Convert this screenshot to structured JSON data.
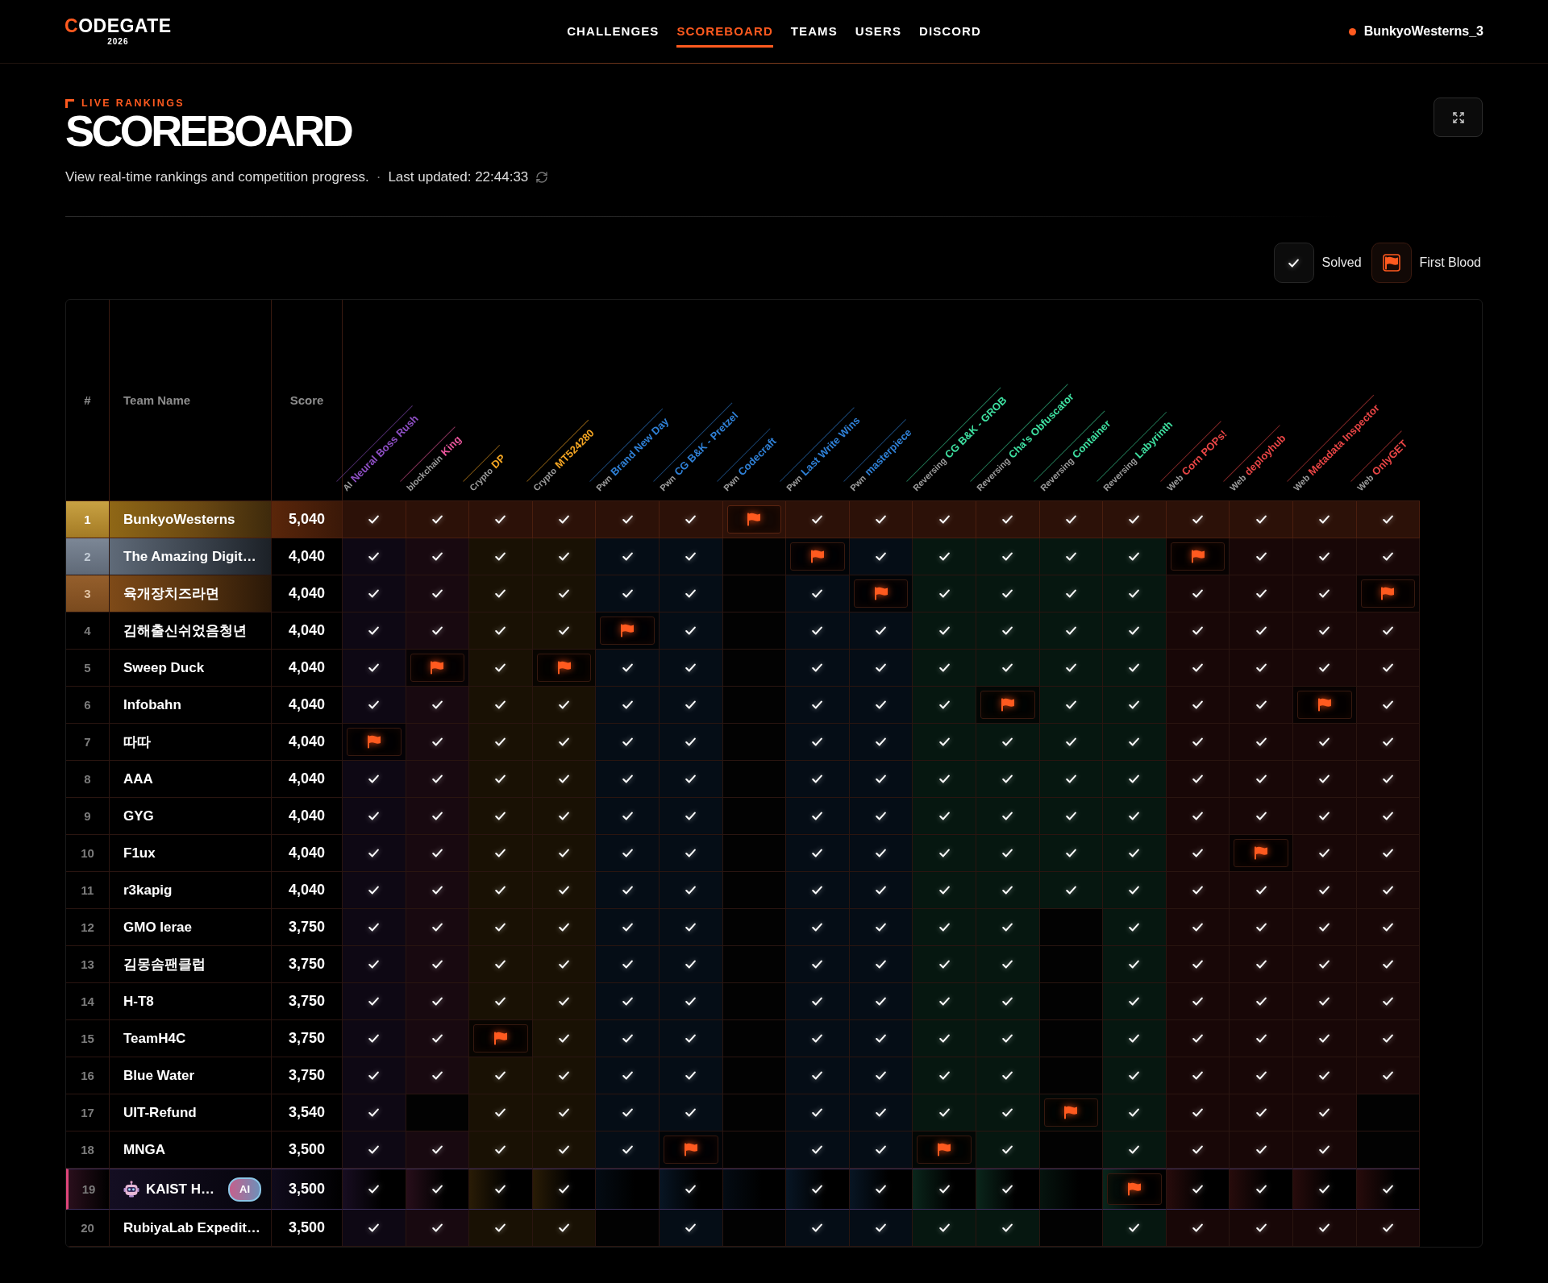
{
  "nav": {
    "logo": {
      "text": "CODEGATE",
      "year": "2026"
    },
    "links": [
      {
        "label": "CHALLENGES",
        "selected": false
      },
      {
        "label": "SCOREBOARD",
        "selected": true
      },
      {
        "label": "TEAMS",
        "selected": false
      },
      {
        "label": "USERS",
        "selected": false
      },
      {
        "label": "DISCORD",
        "selected": false
      }
    ],
    "user": "BunkyoWesterns_3"
  },
  "header": {
    "eyebrow": "LIVE RANKINGS",
    "title": "SCOREBOARD",
    "subtitle": "View real-time rankings and competition progress.",
    "separator": "·",
    "last_updated": "Last updated: 22:44:33"
  },
  "legend": [
    {
      "kind": "check",
      "label": "Solved"
    },
    {
      "kind": "flag",
      "label": "First Blood"
    }
  ],
  "table": {
    "columns": [
      "#",
      "Team Name",
      "Score"
    ],
    "challenges": [
      {
        "category": "AI",
        "name": "Neural Boss Rush",
        "color": "#8e4fc4"
      },
      {
        "category": "blockchain",
        "name": "King",
        "color": "#e9559b"
      },
      {
        "category": "Crypto",
        "name": "DP",
        "color": "#f5a623"
      },
      {
        "category": "Crypto",
        "name": "MT524280",
        "color": "#f5a623"
      },
      {
        "category": "Pwn",
        "name": "Brand New Day",
        "color": "#2f80d6"
      },
      {
        "category": "Pwn",
        "name": "CG B&K - Pretzel",
        "color": "#2f80d6"
      },
      {
        "category": "Pwn",
        "name": "Codecraft",
        "color": "#2f80d6"
      },
      {
        "category": "Pwn",
        "name": "Last Write Wins",
        "color": "#2f80d6"
      },
      {
        "category": "Pwn",
        "name": "masterpiece",
        "color": "#2f80d6"
      },
      {
        "category": "Reversing",
        "name": "CG B&K - GROB",
        "color": "#3ee0a1"
      },
      {
        "category": "Reversing",
        "name": "Cha's Obfuscator",
        "color": "#3ee0a1"
      },
      {
        "category": "Reversing",
        "name": "Container",
        "color": "#3ee0a1"
      },
      {
        "category": "Reversing",
        "name": "Labyrinth",
        "color": "#3ee0a1"
      },
      {
        "category": "Web",
        "name": "Corn POPs!",
        "color": "#e84545"
      },
      {
        "category": "Web",
        "name": "deployhub",
        "color": "#e84545"
      },
      {
        "category": "Web",
        "name": "Metadata Inspector",
        "color": "#e84545"
      },
      {
        "category": "Web",
        "name": "OnlyGET",
        "color": "#e84545"
      }
    ],
    "rows": [
      {
        "rank": "1",
        "team": "BunkyoWesterns",
        "score": "5,040",
        "kind": "gold",
        "cells": [
          {
            "solved": true,
            "first_blood": false
          },
          {
            "solved": true,
            "first_blood": false
          },
          {
            "solved": true,
            "first_blood": false
          },
          {
            "solved": true,
            "first_blood": false
          },
          {
            "solved": true,
            "first_blood": false
          },
          {
            "solved": true,
            "first_blood": false
          },
          {
            "solved": true,
            "first_blood": true
          },
          {
            "solved": true,
            "first_blood": false
          },
          {
            "solved": true,
            "first_blood": false
          },
          {
            "solved": true,
            "first_blood": false
          },
          {
            "solved": true,
            "first_blood": false
          },
          {
            "solved": true,
            "first_blood": false
          },
          {
            "solved": true,
            "first_blood": false
          },
          {
            "solved": true,
            "first_blood": false
          },
          {
            "solved": true,
            "first_blood": false
          },
          {
            "solved": true,
            "first_blood": false
          },
          {
            "solved": true,
            "first_blood": false
          }
        ]
      },
      {
        "rank": "2",
        "team": "The Amazing Digit…",
        "score": "4,040",
        "kind": "silver",
        "cells": [
          {
            "solved": true,
            "first_blood": false
          },
          {
            "solved": true,
            "first_blood": false
          },
          {
            "solved": true,
            "first_blood": false
          },
          {
            "solved": true,
            "first_blood": false
          },
          {
            "solved": true,
            "first_blood": false
          },
          {
            "solved": true,
            "first_blood": false
          },
          {
            "solved": false,
            "first_blood": false
          },
          {
            "solved": true,
            "first_blood": true
          },
          {
            "solved": true,
            "first_blood": false
          },
          {
            "solved": true,
            "first_blood": false
          },
          {
            "solved": true,
            "first_blood": false
          },
          {
            "solved": true,
            "first_blood": false
          },
          {
            "solved": true,
            "first_blood": false
          },
          {
            "solved": true,
            "first_blood": true
          },
          {
            "solved": true,
            "first_blood": false
          },
          {
            "solved": true,
            "first_blood": false
          },
          {
            "solved": true,
            "first_blood": false
          }
        ]
      },
      {
        "rank": "3",
        "team": "육개장치즈라면",
        "score": "4,040",
        "kind": "bronze",
        "cells": [
          {
            "solved": true,
            "first_blood": false
          },
          {
            "solved": true,
            "first_blood": false
          },
          {
            "solved": true,
            "first_blood": false
          },
          {
            "solved": true,
            "first_blood": false
          },
          {
            "solved": true,
            "first_blood": false
          },
          {
            "solved": true,
            "first_blood": false
          },
          {
            "solved": false,
            "first_blood": false
          },
          {
            "solved": true,
            "first_blood": false
          },
          {
            "solved": true,
            "first_blood": true
          },
          {
            "solved": true,
            "first_blood": false
          },
          {
            "solved": true,
            "first_blood": false
          },
          {
            "solved": true,
            "first_blood": false
          },
          {
            "solved": true,
            "first_blood": false
          },
          {
            "solved": true,
            "first_blood": false
          },
          {
            "solved": true,
            "first_blood": false
          },
          {
            "solved": true,
            "first_blood": false
          },
          {
            "solved": true,
            "first_blood": true
          }
        ]
      },
      {
        "rank": "4",
        "team": "김해출신쉬었음청년",
        "score": "4,040",
        "kind": "normal",
        "cells": [
          {
            "solved": true,
            "first_blood": false
          },
          {
            "solved": true,
            "first_blood": false
          },
          {
            "solved": true,
            "first_blood": false
          },
          {
            "solved": true,
            "first_blood": false
          },
          {
            "solved": true,
            "first_blood": true
          },
          {
            "solved": true,
            "first_blood": false
          },
          {
            "solved": false,
            "first_blood": false
          },
          {
            "solved": true,
            "first_blood": false
          },
          {
            "solved": true,
            "first_blood": false
          },
          {
            "solved": true,
            "first_blood": false
          },
          {
            "solved": true,
            "first_blood": false
          },
          {
            "solved": true,
            "first_blood": false
          },
          {
            "solved": true,
            "first_blood": false
          },
          {
            "solved": true,
            "first_blood": false
          },
          {
            "solved": true,
            "first_blood": false
          },
          {
            "solved": true,
            "first_blood": false
          },
          {
            "solved": true,
            "first_blood": false
          }
        ]
      },
      {
        "rank": "5",
        "team": "Sweep Duck",
        "score": "4,040",
        "kind": "normal",
        "cells": [
          {
            "solved": true,
            "first_blood": false
          },
          {
            "solved": true,
            "first_blood": true
          },
          {
            "solved": true,
            "first_blood": false
          },
          {
            "solved": true,
            "first_blood": true
          },
          {
            "solved": true,
            "first_blood": false
          },
          {
            "solved": true,
            "first_blood": false
          },
          {
            "solved": false,
            "first_blood": false
          },
          {
            "solved": true,
            "first_blood": false
          },
          {
            "solved": true,
            "first_blood": false
          },
          {
            "solved": true,
            "first_blood": false
          },
          {
            "solved": true,
            "first_blood": false
          },
          {
            "solved": true,
            "first_blood": false
          },
          {
            "solved": true,
            "first_blood": false
          },
          {
            "solved": true,
            "first_blood": false
          },
          {
            "solved": true,
            "first_blood": false
          },
          {
            "solved": true,
            "first_blood": false
          },
          {
            "solved": true,
            "first_blood": false
          }
        ]
      },
      {
        "rank": "6",
        "team": "Infobahn",
        "score": "4,040",
        "kind": "normal",
        "cells": [
          {
            "solved": true,
            "first_blood": false
          },
          {
            "solved": true,
            "first_blood": false
          },
          {
            "solved": true,
            "first_blood": false
          },
          {
            "solved": true,
            "first_blood": false
          },
          {
            "solved": true,
            "first_blood": false
          },
          {
            "solved": true,
            "first_blood": false
          },
          {
            "solved": false,
            "first_blood": false
          },
          {
            "solved": true,
            "first_blood": false
          },
          {
            "solved": true,
            "first_blood": false
          },
          {
            "solved": true,
            "first_blood": false
          },
          {
            "solved": true,
            "first_blood": true
          },
          {
            "solved": true,
            "first_blood": false
          },
          {
            "solved": true,
            "first_blood": false
          },
          {
            "solved": true,
            "first_blood": false
          },
          {
            "solved": true,
            "first_blood": false
          },
          {
            "solved": true,
            "first_blood": true
          },
          {
            "solved": true,
            "first_blood": false
          }
        ]
      },
      {
        "rank": "7",
        "team": "따따",
        "score": "4,040",
        "kind": "normal",
        "cells": [
          {
            "solved": true,
            "first_blood": true
          },
          {
            "solved": true,
            "first_blood": false
          },
          {
            "solved": true,
            "first_blood": false
          },
          {
            "solved": true,
            "first_blood": false
          },
          {
            "solved": true,
            "first_blood": false
          },
          {
            "solved": true,
            "first_blood": false
          },
          {
            "solved": false,
            "first_blood": false
          },
          {
            "solved": true,
            "first_blood": false
          },
          {
            "solved": true,
            "first_blood": false
          },
          {
            "solved": true,
            "first_blood": false
          },
          {
            "solved": true,
            "first_blood": false
          },
          {
            "solved": true,
            "first_blood": false
          },
          {
            "solved": true,
            "first_blood": false
          },
          {
            "solved": true,
            "first_blood": false
          },
          {
            "solved": true,
            "first_blood": false
          },
          {
            "solved": true,
            "first_blood": false
          },
          {
            "solved": true,
            "first_blood": false
          }
        ]
      },
      {
        "rank": "8",
        "team": "AAA",
        "score": "4,040",
        "kind": "normal",
        "cells": [
          {
            "solved": true,
            "first_blood": false
          },
          {
            "solved": true,
            "first_blood": false
          },
          {
            "solved": true,
            "first_blood": false
          },
          {
            "solved": true,
            "first_blood": false
          },
          {
            "solved": true,
            "first_blood": false
          },
          {
            "solved": true,
            "first_blood": false
          },
          {
            "solved": false,
            "first_blood": false
          },
          {
            "solved": true,
            "first_blood": false
          },
          {
            "solved": true,
            "first_blood": false
          },
          {
            "solved": true,
            "first_blood": false
          },
          {
            "solved": true,
            "first_blood": false
          },
          {
            "solved": true,
            "first_blood": false
          },
          {
            "solved": true,
            "first_blood": false
          },
          {
            "solved": true,
            "first_blood": false
          },
          {
            "solved": true,
            "first_blood": false
          },
          {
            "solved": true,
            "first_blood": false
          },
          {
            "solved": true,
            "first_blood": false
          }
        ]
      },
      {
        "rank": "9",
        "team": "GYG",
        "score": "4,040",
        "kind": "normal",
        "cells": [
          {
            "solved": true,
            "first_blood": false
          },
          {
            "solved": true,
            "first_blood": false
          },
          {
            "solved": true,
            "first_blood": false
          },
          {
            "solved": true,
            "first_blood": false
          },
          {
            "solved": true,
            "first_blood": false
          },
          {
            "solved": true,
            "first_blood": false
          },
          {
            "solved": false,
            "first_blood": false
          },
          {
            "solved": true,
            "first_blood": false
          },
          {
            "solved": true,
            "first_blood": false
          },
          {
            "solved": true,
            "first_blood": false
          },
          {
            "solved": true,
            "first_blood": false
          },
          {
            "solved": true,
            "first_blood": false
          },
          {
            "solved": true,
            "first_blood": false
          },
          {
            "solved": true,
            "first_blood": false
          },
          {
            "solved": true,
            "first_blood": false
          },
          {
            "solved": true,
            "first_blood": false
          },
          {
            "solved": true,
            "first_blood": false
          }
        ]
      },
      {
        "rank": "10",
        "team": "F1ux",
        "score": "4,040",
        "kind": "normal",
        "cells": [
          {
            "solved": true,
            "first_blood": false
          },
          {
            "solved": true,
            "first_blood": false
          },
          {
            "solved": true,
            "first_blood": false
          },
          {
            "solved": true,
            "first_blood": false
          },
          {
            "solved": true,
            "first_blood": false
          },
          {
            "solved": true,
            "first_blood": false
          },
          {
            "solved": false,
            "first_blood": false
          },
          {
            "solved": true,
            "first_blood": false
          },
          {
            "solved": true,
            "first_blood": false
          },
          {
            "solved": true,
            "first_blood": false
          },
          {
            "solved": true,
            "first_blood": false
          },
          {
            "solved": true,
            "first_blood": false
          },
          {
            "solved": true,
            "first_blood": false
          },
          {
            "solved": true,
            "first_blood": false
          },
          {
            "solved": true,
            "first_blood": true
          },
          {
            "solved": true,
            "first_blood": false
          },
          {
            "solved": true,
            "first_blood": false
          }
        ]
      },
      {
        "rank": "11",
        "team": "r3kapig",
        "score": "4,040",
        "kind": "normal",
        "cells": [
          {
            "solved": true,
            "first_blood": false
          },
          {
            "solved": true,
            "first_blood": false
          },
          {
            "solved": true,
            "first_blood": false
          },
          {
            "solved": true,
            "first_blood": false
          },
          {
            "solved": true,
            "first_blood": false
          },
          {
            "solved": true,
            "first_blood": false
          },
          {
            "solved": false,
            "first_blood": false
          },
          {
            "solved": true,
            "first_blood": false
          },
          {
            "solved": true,
            "first_blood": false
          },
          {
            "solved": true,
            "first_blood": false
          },
          {
            "solved": true,
            "first_blood": false
          },
          {
            "solved": true,
            "first_blood": false
          },
          {
            "solved": true,
            "first_blood": false
          },
          {
            "solved": true,
            "first_blood": false
          },
          {
            "solved": true,
            "first_blood": false
          },
          {
            "solved": true,
            "first_blood": false
          },
          {
            "solved": true,
            "first_blood": false
          }
        ]
      },
      {
        "rank": "12",
        "team": "GMO Ierae",
        "score": "3,750",
        "kind": "normal",
        "cells": [
          {
            "solved": true,
            "first_blood": false
          },
          {
            "solved": true,
            "first_blood": false
          },
          {
            "solved": true,
            "first_blood": false
          },
          {
            "solved": true,
            "first_blood": false
          },
          {
            "solved": true,
            "first_blood": false
          },
          {
            "solved": true,
            "first_blood": false
          },
          {
            "solved": false,
            "first_blood": false
          },
          {
            "solved": true,
            "first_blood": false
          },
          {
            "solved": true,
            "first_blood": false
          },
          {
            "solved": true,
            "first_blood": false
          },
          {
            "solved": true,
            "first_blood": false
          },
          {
            "solved": false,
            "first_blood": false
          },
          {
            "solved": true,
            "first_blood": false
          },
          {
            "solved": true,
            "first_blood": false
          },
          {
            "solved": true,
            "first_blood": false
          },
          {
            "solved": true,
            "first_blood": false
          },
          {
            "solved": true,
            "first_blood": false
          }
        ]
      },
      {
        "rank": "13",
        "team": "김몽솜팬클럽",
        "score": "3,750",
        "kind": "normal",
        "cells": [
          {
            "solved": true,
            "first_blood": false
          },
          {
            "solved": true,
            "first_blood": false
          },
          {
            "solved": true,
            "first_blood": false
          },
          {
            "solved": true,
            "first_blood": false
          },
          {
            "solved": true,
            "first_blood": false
          },
          {
            "solved": true,
            "first_blood": false
          },
          {
            "solved": false,
            "first_blood": false
          },
          {
            "solved": true,
            "first_blood": false
          },
          {
            "solved": true,
            "first_blood": false
          },
          {
            "solved": true,
            "first_blood": false
          },
          {
            "solved": true,
            "first_blood": false
          },
          {
            "solved": false,
            "first_blood": false
          },
          {
            "solved": true,
            "first_blood": false
          },
          {
            "solved": true,
            "first_blood": false
          },
          {
            "solved": true,
            "first_blood": false
          },
          {
            "solved": true,
            "first_blood": false
          },
          {
            "solved": true,
            "first_blood": false
          }
        ]
      },
      {
        "rank": "14",
        "team": "H-T8",
        "score": "3,750",
        "kind": "normal",
        "cells": [
          {
            "solved": true,
            "first_blood": false
          },
          {
            "solved": true,
            "first_blood": false
          },
          {
            "solved": true,
            "first_blood": false
          },
          {
            "solved": true,
            "first_blood": false
          },
          {
            "solved": true,
            "first_blood": false
          },
          {
            "solved": true,
            "first_blood": false
          },
          {
            "solved": false,
            "first_blood": false
          },
          {
            "solved": true,
            "first_blood": false
          },
          {
            "solved": true,
            "first_blood": false
          },
          {
            "solved": true,
            "first_blood": false
          },
          {
            "solved": true,
            "first_blood": false
          },
          {
            "solved": false,
            "first_blood": false
          },
          {
            "solved": true,
            "first_blood": false
          },
          {
            "solved": true,
            "first_blood": false
          },
          {
            "solved": true,
            "first_blood": false
          },
          {
            "solved": true,
            "first_blood": false
          },
          {
            "solved": true,
            "first_blood": false
          }
        ]
      },
      {
        "rank": "15",
        "team": "TeamH4C",
        "score": "3,750",
        "kind": "normal",
        "cells": [
          {
            "solved": true,
            "first_blood": false
          },
          {
            "solved": true,
            "first_blood": false
          },
          {
            "solved": true,
            "first_blood": true
          },
          {
            "solved": true,
            "first_blood": false
          },
          {
            "solved": true,
            "first_blood": false
          },
          {
            "solved": true,
            "first_blood": false
          },
          {
            "solved": false,
            "first_blood": false
          },
          {
            "solved": true,
            "first_blood": false
          },
          {
            "solved": true,
            "first_blood": false
          },
          {
            "solved": true,
            "first_blood": false
          },
          {
            "solved": true,
            "first_blood": false
          },
          {
            "solved": false,
            "first_blood": false
          },
          {
            "solved": true,
            "first_blood": false
          },
          {
            "solved": true,
            "first_blood": false
          },
          {
            "solved": true,
            "first_blood": false
          },
          {
            "solved": true,
            "first_blood": false
          },
          {
            "solved": true,
            "first_blood": false
          }
        ]
      },
      {
        "rank": "16",
        "team": "Blue Water",
        "score": "3,750",
        "kind": "normal",
        "cells": [
          {
            "solved": true,
            "first_blood": false
          },
          {
            "solved": true,
            "first_blood": false
          },
          {
            "solved": true,
            "first_blood": false
          },
          {
            "solved": true,
            "first_blood": false
          },
          {
            "solved": true,
            "first_blood": false
          },
          {
            "solved": true,
            "first_blood": false
          },
          {
            "solved": false,
            "first_blood": false
          },
          {
            "solved": true,
            "first_blood": false
          },
          {
            "solved": true,
            "first_blood": false
          },
          {
            "solved": true,
            "first_blood": false
          },
          {
            "solved": true,
            "first_blood": false
          },
          {
            "solved": false,
            "first_blood": false
          },
          {
            "solved": true,
            "first_blood": false
          },
          {
            "solved": true,
            "first_blood": false
          },
          {
            "solved": true,
            "first_blood": false
          },
          {
            "solved": true,
            "first_blood": false
          },
          {
            "solved": true,
            "first_blood": false
          }
        ]
      },
      {
        "rank": "17",
        "team": "UIT-Refund",
        "score": "3,540",
        "kind": "normal",
        "cells": [
          {
            "solved": true,
            "first_blood": false
          },
          {
            "solved": false,
            "first_blood": false
          },
          {
            "solved": true,
            "first_blood": false
          },
          {
            "solved": true,
            "first_blood": false
          },
          {
            "solved": true,
            "first_blood": false
          },
          {
            "solved": true,
            "first_blood": false
          },
          {
            "solved": false,
            "first_blood": false
          },
          {
            "solved": true,
            "first_blood": false
          },
          {
            "solved": true,
            "first_blood": false
          },
          {
            "solved": true,
            "first_blood": false
          },
          {
            "solved": true,
            "first_blood": false
          },
          {
            "solved": true,
            "first_blood": true
          },
          {
            "solved": true,
            "first_blood": false
          },
          {
            "solved": true,
            "first_blood": false
          },
          {
            "solved": true,
            "first_blood": false
          },
          {
            "solved": true,
            "first_blood": false
          },
          {
            "solved": false,
            "first_blood": false
          }
        ]
      },
      {
        "rank": "18",
        "team": "MNGA",
        "score": "3,500",
        "kind": "normal",
        "cells": [
          {
            "solved": true,
            "first_blood": false
          },
          {
            "solved": true,
            "first_blood": false
          },
          {
            "solved": true,
            "first_blood": false
          },
          {
            "solved": true,
            "first_blood": false
          },
          {
            "solved": true,
            "first_blood": false
          },
          {
            "solved": true,
            "first_blood": true
          },
          {
            "solved": false,
            "first_blood": false
          },
          {
            "solved": true,
            "first_blood": false
          },
          {
            "solved": true,
            "first_blood": false
          },
          {
            "solved": true,
            "first_blood": true
          },
          {
            "solved": true,
            "first_blood": false
          },
          {
            "solved": false,
            "first_blood": false
          },
          {
            "solved": true,
            "first_blood": false
          },
          {
            "solved": true,
            "first_blood": false
          },
          {
            "solved": true,
            "first_blood": false
          },
          {
            "solved": true,
            "first_blood": false
          },
          {
            "solved": false,
            "first_blood": false
          }
        ]
      },
      {
        "rank": "19",
        "team": "KAIST H…",
        "badge": "AI",
        "score": "3,500",
        "kind": "ai",
        "cells": [
          {
            "solved": true,
            "first_blood": false
          },
          {
            "solved": true,
            "first_blood": false
          },
          {
            "solved": true,
            "first_blood": false
          },
          {
            "solved": true,
            "first_blood": false
          },
          {
            "solved": false,
            "first_blood": false
          },
          {
            "solved": true,
            "first_blood": false
          },
          {
            "solved": false,
            "first_blood": false
          },
          {
            "solved": true,
            "first_blood": false
          },
          {
            "solved": true,
            "first_blood": false
          },
          {
            "solved": true,
            "first_blood": false
          },
          {
            "solved": true,
            "first_blood": false
          },
          {
            "solved": false,
            "first_blood": false
          },
          {
            "solved": true,
            "first_blood": true
          },
          {
            "solved": true,
            "first_blood": false
          },
          {
            "solved": true,
            "first_blood": false
          },
          {
            "solved": true,
            "first_blood": false
          },
          {
            "solved": true,
            "first_blood": false
          }
        ]
      },
      {
        "rank": "20",
        "team": "RubiyaLab Expedit…",
        "score": "3,500",
        "kind": "normal",
        "cells": [
          {
            "solved": true,
            "first_blood": false
          },
          {
            "solved": true,
            "first_blood": false
          },
          {
            "solved": true,
            "first_blood": false
          },
          {
            "solved": true,
            "first_blood": false
          },
          {
            "solved": false,
            "first_blood": false
          },
          {
            "solved": true,
            "first_blood": false
          },
          {
            "solved": false,
            "first_blood": false
          },
          {
            "solved": true,
            "first_blood": false
          },
          {
            "solved": true,
            "first_blood": false
          },
          {
            "solved": true,
            "first_blood": false
          },
          {
            "solved": true,
            "first_blood": false
          },
          {
            "solved": false,
            "first_blood": false
          },
          {
            "solved": true,
            "first_blood": false
          },
          {
            "solved": true,
            "first_blood": false
          },
          {
            "solved": true,
            "first_blood": false
          },
          {
            "solved": true,
            "first_blood": false
          },
          {
            "solved": true,
            "first_blood": false
          }
        ]
      }
    ]
  }
}
